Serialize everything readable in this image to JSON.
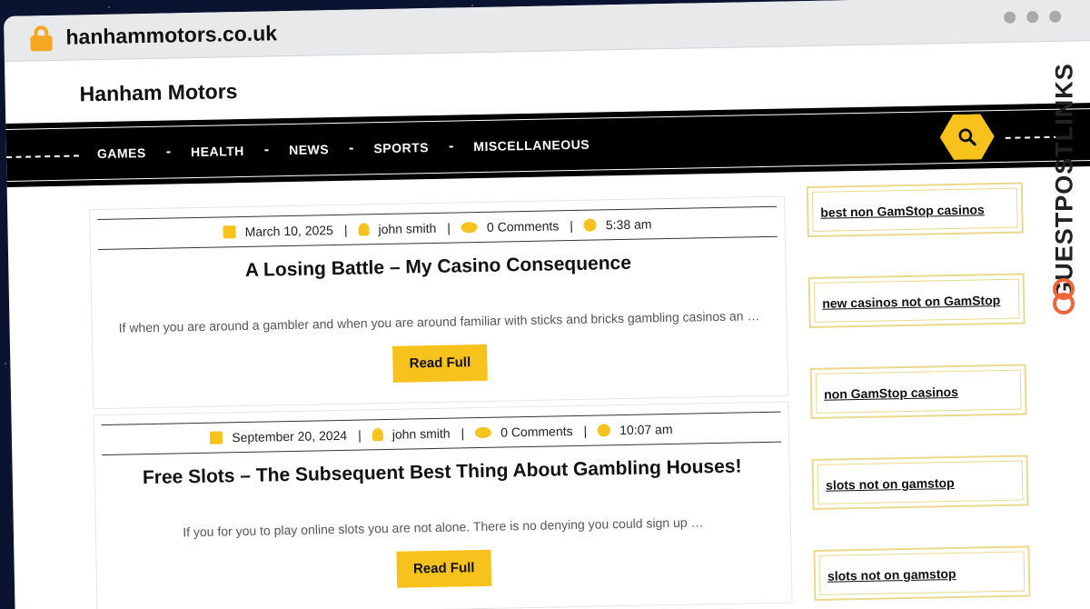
{
  "browser": {
    "url": "hanhammotors.co.uk"
  },
  "site": {
    "title": "Hanham Motors"
  },
  "nav": {
    "items": [
      "GAMES",
      "HEALTH",
      "NEWS",
      "SPORTS",
      "MISCELLANEOUS"
    ]
  },
  "colors": {
    "accent": "#f8c21c",
    "nav_bg": "#000000",
    "lock": "#f5a623"
  },
  "posts": [
    {
      "date": "March 10, 2025",
      "author": "john smith",
      "comments": "0 Comments",
      "time": "5:38 am",
      "title": "A Losing Battle – My Casino Consequence",
      "excerpt": "If when you are around a gambler and when you are around familiar with sticks and bricks gambling casinos an …",
      "button": "Read Full"
    },
    {
      "date": "September 20, 2024",
      "author": "john smith",
      "comments": "0 Comments",
      "time": "10:07 am",
      "title": "Free Slots – The Subsequent Best Thing About Gambling Houses!",
      "excerpt": "If you for you to play online slots you are not alone. There is no denying you could sign up …",
      "button": "Read Full"
    }
  ],
  "sidebar": {
    "links": [
      "best non GamStop casinos",
      "new casinos not on GamStop",
      "non GamStop casinos",
      "slots not on gamstop",
      "slots not on gamstop"
    ]
  },
  "brand": {
    "text": "GUESTPOSTLINKS"
  },
  "icons": {
    "lock": "lock-icon",
    "search": "search-icon",
    "calendar": "calendar-icon",
    "user": "user-icon",
    "comments": "comments-icon",
    "clock": "clock-icon"
  }
}
